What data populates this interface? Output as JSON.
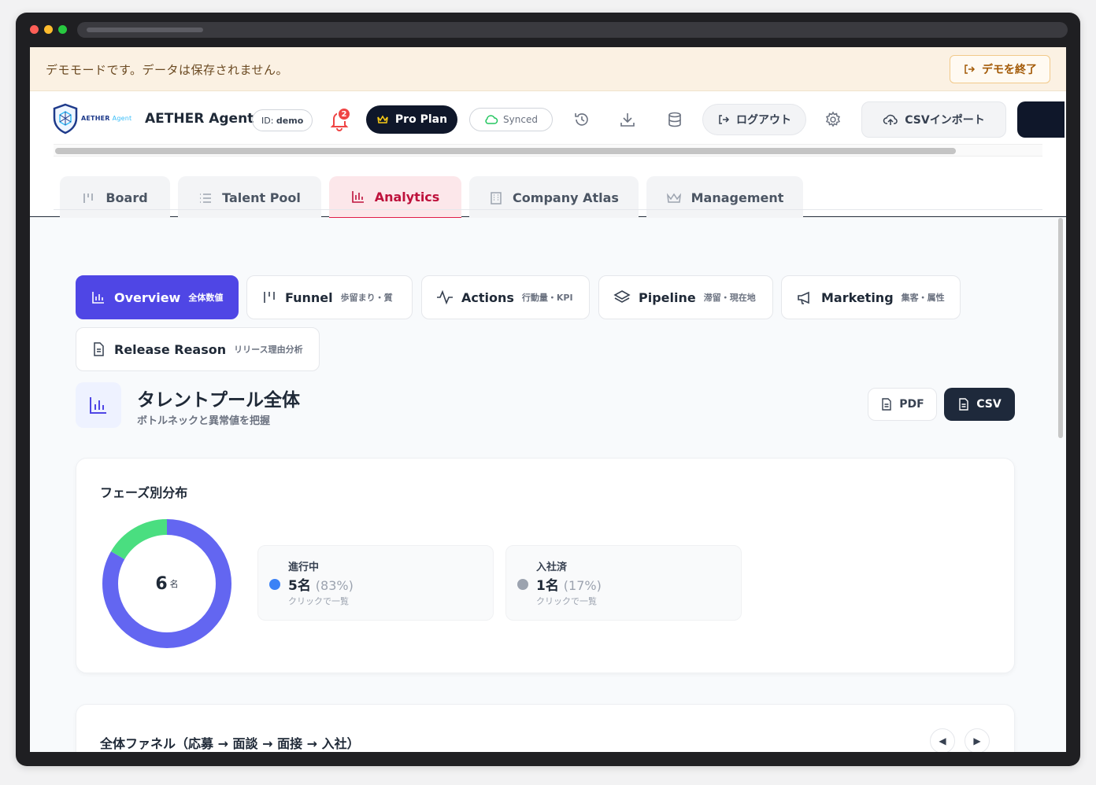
{
  "banner": {
    "text": "デモモードです。データは保存されません。",
    "exit_label": "デモを終了"
  },
  "header": {
    "logo_text_main": "AETHER",
    "logo_text_sub": "Agent",
    "app_name": "AETHER Agent",
    "id_prefix": "ID: ",
    "id_value": "demo",
    "notification_count": "2",
    "plan_label": "Pro Plan",
    "sync_label": "Synced",
    "logout_label": "ログアウト",
    "csv_import_label": "CSVインポート"
  },
  "tabs": [
    {
      "label": "Board",
      "icon": "board-icon"
    },
    {
      "label": "Talent Pool",
      "icon": "list-icon"
    },
    {
      "label": "Analytics",
      "icon": "bar-chart-icon",
      "active": true
    },
    {
      "label": "Company Atlas",
      "icon": "building-icon"
    },
    {
      "label": "Management",
      "icon": "crown-icon"
    }
  ],
  "subtabs": [
    {
      "label": "Overview",
      "sub": "全体数値",
      "active": true
    },
    {
      "label": "Funnel",
      "sub": "歩留まり・質"
    },
    {
      "label": "Actions",
      "sub": "行動量・KPI"
    },
    {
      "label": "Pipeline",
      "sub": "滞留・現在地"
    },
    {
      "label": "Marketing",
      "sub": "集客・属性"
    },
    {
      "label": "Release Reason",
      "sub": "リリース理由分析"
    }
  ],
  "section": {
    "title": "タレントプール全体",
    "subtitle": "ボトルネックと異常値を把握",
    "pdf_label": "PDF",
    "csv_label": "CSV"
  },
  "phase_card": {
    "title": "フェーズ別分布",
    "total": "6",
    "total_unit": "名",
    "items": [
      {
        "name": "進行中",
        "count": "5名",
        "pct": "(83%)",
        "hint": "クリックで一覧",
        "color": "#6366f1",
        "dot_color": "#3b82f6",
        "fraction": 0.833
      },
      {
        "name": "入社済",
        "count": "1名",
        "pct": "(17%)",
        "hint": "クリックで一覧",
        "color": "#4ade80",
        "dot_color": "#9ca3af",
        "fraction": 0.167
      }
    ]
  },
  "funnel_card": {
    "title": "全体ファネル（応募 → 面談 → 面接 → 入社）"
  },
  "colors": {
    "accent": "#4f46e5",
    "active_tab": "#e11d48",
    "banner_bg": "#fbf1e3"
  }
}
